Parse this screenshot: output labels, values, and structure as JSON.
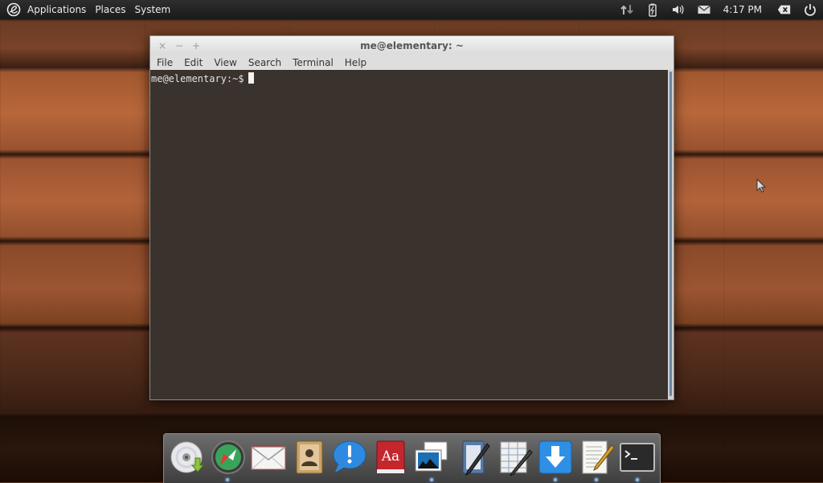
{
  "panel": {
    "menus": [
      "Applications",
      "Places",
      "System"
    ],
    "clock": "4:17 PM"
  },
  "window": {
    "title": "me@elementary: ~",
    "menus": [
      "File",
      "Edit",
      "View",
      "Search",
      "Terminal",
      "Help"
    ],
    "buttons": {
      "close": "×",
      "minimize": "−",
      "maximize": "+"
    },
    "prompt": "me@elementary:~$"
  },
  "dock": {
    "items": [
      {
        "icon": "disc-install-icon",
        "running": false
      },
      {
        "icon": "compass-browser-icon",
        "running": true
      },
      {
        "icon": "mail-envelope-icon",
        "running": false
      },
      {
        "icon": "address-book-icon",
        "running": false
      },
      {
        "icon": "chat-bubble-icon",
        "running": false
      },
      {
        "icon": "dictionary-icon",
        "running": false
      },
      {
        "icon": "photos-icon",
        "running": true
      },
      {
        "icon": "notebook-pen-icon",
        "running": false
      },
      {
        "icon": "spreadsheet-pen-icon",
        "running": false
      },
      {
        "icon": "download-arrow-icon",
        "running": true
      },
      {
        "icon": "text-editor-icon",
        "running": true
      },
      {
        "icon": "terminal-icon",
        "running": true
      }
    ]
  },
  "colors": {
    "panel": "#1f1f1f",
    "terminal_bg": "#1e1008",
    "scroll_thumb": "#6a87a6",
    "dock": "#555555"
  }
}
